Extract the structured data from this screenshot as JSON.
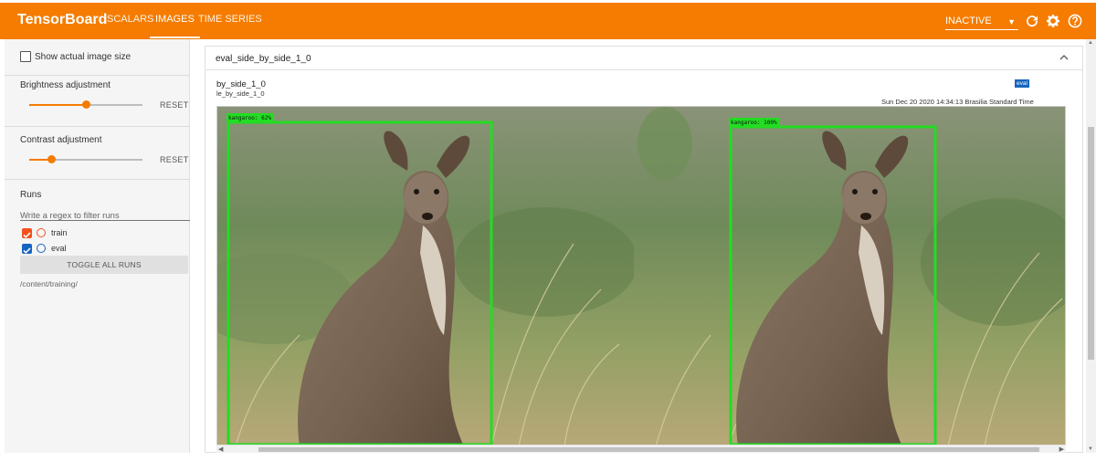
{
  "app": {
    "title": "TensorBoard"
  },
  "nav": {
    "tabs": [
      {
        "label": "SCALARS",
        "active": false
      },
      {
        "label": "IMAGES",
        "active": true
      },
      {
        "label": "TIME SERIES",
        "active": false
      }
    ],
    "status_select": {
      "value": "INACTIVE"
    }
  },
  "sidebar": {
    "show_actual_size": {
      "label": "Show actual image size",
      "checked": false
    },
    "brightness": {
      "label": "Brightness adjustment",
      "reset_label": "RESET",
      "value": 0.5
    },
    "contrast": {
      "label": "Contrast adjustment",
      "reset_label": "RESET",
      "value": 0.2
    },
    "runs": {
      "title": "Runs",
      "filter_placeholder": "Write a regex to filter runs",
      "items": [
        {
          "name": "train",
          "checked": true,
          "color": "#f4511e"
        },
        {
          "name": "eval",
          "checked": true,
          "color": "#1565c0"
        }
      ],
      "toggle_label": "TOGGLE ALL RUNS",
      "log_dir": "/content/training/"
    }
  },
  "card": {
    "title": "eval_side_by_side_1_0",
    "image_title": "by_side_1_0",
    "image_subtitle": "le_by_side_1_0",
    "run_badge": "eval",
    "timestamp": "Sun Dec 20 2020 14:34:13 Brasilia Standard Time",
    "left_label": "kangaroo: 62%",
    "right_label": "kangaroo: 100%"
  },
  "colors": {
    "accent": "#f57c00",
    "box": "#22dd22",
    "train": "#f4511e",
    "eval": "#1565c0"
  },
  "icons": {
    "refresh": "refresh-icon",
    "settings": "gear-icon",
    "help": "help-icon",
    "expand": "chevron-up-icon"
  }
}
